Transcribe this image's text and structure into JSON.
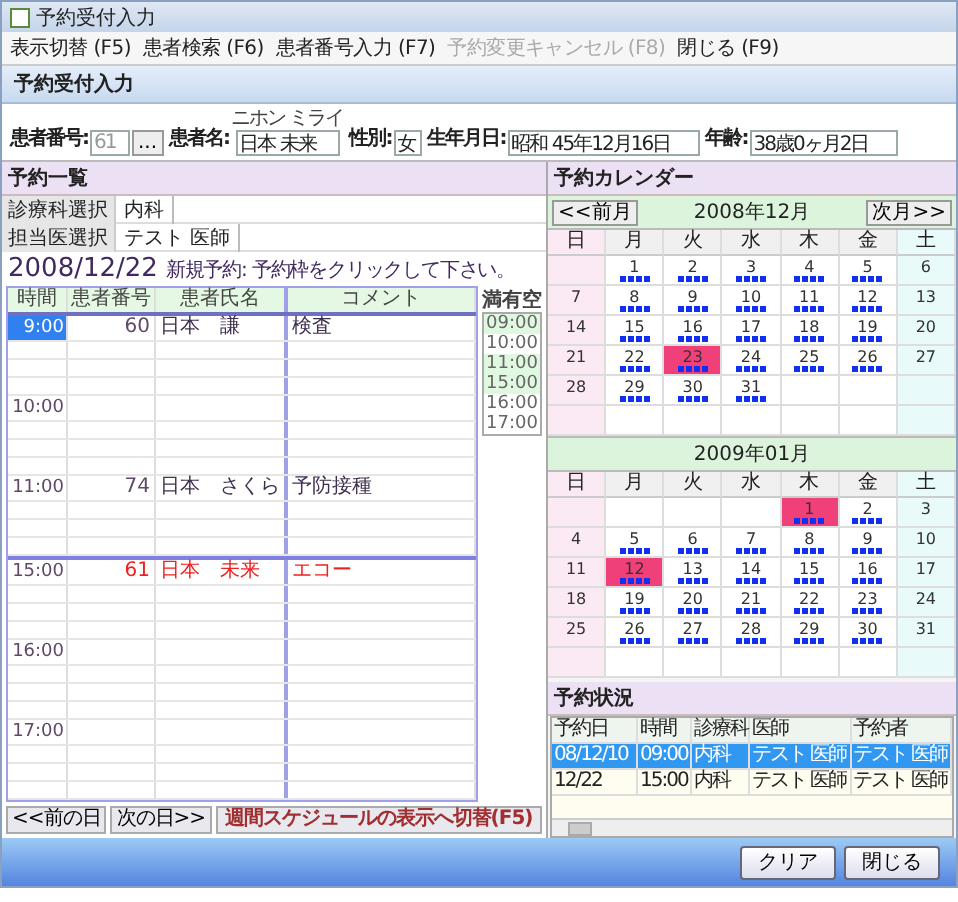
{
  "window": {
    "title": "予約受付入力"
  },
  "menu": [
    {
      "label": "表示切替",
      "key": "(F5)",
      "disabled": false
    },
    {
      "label": "患者検索",
      "key": "(F6)",
      "disabled": false
    },
    {
      "label": "患者番号入力",
      "key": "(F7)",
      "disabled": false
    },
    {
      "label": "予約変更キャンセル",
      "key": "(F8)",
      "disabled": true
    },
    {
      "label": "閉じる",
      "key": "(F9)",
      "disabled": false
    }
  ],
  "heading": "予約受付入力",
  "patient": {
    "number_label": "患者番号:",
    "number": "61",
    "browse": "...",
    "name_label": "患者名:",
    "name_reading": "ニホン ミライ",
    "name": "日本 未来",
    "sex_label": "性別:",
    "sex": "女",
    "birth_label": "生年月日:",
    "birth": "昭和 45年12月16日",
    "age_label": "年齢:",
    "age": "38歳0ヶ月2日"
  },
  "list": {
    "title": "予約一覧",
    "department_label": "診療科選択",
    "department": "内科",
    "doctor_label": "担当医選択",
    "doctor": "テスト 医師",
    "date": "2008/12/22",
    "hint": "新規予約: 予約枠をクリックして下さい。",
    "columns": [
      "時間",
      "患者番号",
      "患者氏名",
      "コメント"
    ],
    "hours": [
      {
        "time": "9:00",
        "selected": true,
        "break_before": false,
        "booking": {
          "number": "60",
          "name": "日本　謙",
          "comment": "検査",
          "current": false
        }
      },
      {
        "time": "10:00",
        "selected": false,
        "break_before": false
      },
      {
        "time": "11:00",
        "selected": false,
        "break_before": false,
        "booking": {
          "number": "74",
          "name": "日本　さくら",
          "comment": "予防接種",
          "current": false
        }
      },
      {
        "time": "15:00",
        "selected": false,
        "break_before": true,
        "booking": {
          "number": "61",
          "name": "日本　未来",
          "comment": "エコー",
          "current": true
        }
      },
      {
        "time": "16:00",
        "selected": false,
        "break_before": false
      },
      {
        "time": "17:00",
        "selected": false,
        "break_before": false
      }
    ],
    "availability": {
      "columns": [
        "満",
        "有",
        "空"
      ],
      "times": [
        {
          "time": "09:00",
          "booked": true
        },
        {
          "time": "10:00",
          "booked": false
        },
        {
          "time": "11:00",
          "booked": true
        },
        {
          "time": "15:00",
          "booked": true
        },
        {
          "time": "16:00",
          "booked": false
        },
        {
          "time": "17:00",
          "booked": false
        }
      ]
    },
    "prev_day": "<<前の日",
    "next_day": "次の日>>",
    "week_toggle": "週間スケジュールの表示へ切替(F5)"
  },
  "calendar": {
    "title": "予約カレンダー",
    "prev": "<<前月",
    "next": "次月>>",
    "months": [
      {
        "title": "2008年12月",
        "weekdays": [
          "日",
          "月",
          "火",
          "水",
          "木",
          "金",
          "土"
        ],
        "weeks": [
          [
            {
              "label": "1",
              "available": true,
              "holiday": false
            },
            {
              "label": "2",
              "available": true,
              "holiday": false
            },
            {
              "label": "3",
              "available": true,
              "holiday": false
            },
            {
              "label": "4",
              "available": true,
              "holiday": false
            },
            {
              "label": "5",
              "available": true,
              "holiday": false
            },
            {
              "label": "6",
              "available": false,
              "holiday": false
            }
          ],
          [
            {
              "label": "7",
              "available": false,
              "holiday": false
            },
            {
              "label": "8",
              "available": true,
              "holiday": false
            },
            {
              "label": "9",
              "available": true,
              "holiday": false
            },
            {
              "label": "10",
              "available": true,
              "holiday": false
            },
            {
              "label": "11",
              "available": true,
              "holiday": false
            },
            {
              "label": "12",
              "available": true,
              "holiday": false
            },
            {
              "label": "13",
              "available": false,
              "holiday": false
            }
          ],
          [
            {
              "label": "14",
              "available": false,
              "holiday": false
            },
            {
              "label": "15",
              "available": true,
              "holiday": false
            },
            {
              "label": "16",
              "available": true,
              "holiday": false
            },
            {
              "label": "17",
              "available": true,
              "holiday": false
            },
            {
              "label": "18",
              "available": true,
              "holiday": false
            },
            {
              "label": "19",
              "available": true,
              "holiday": false
            },
            {
              "label": "20",
              "available": false,
              "holiday": false
            }
          ],
          [
            {
              "label": "21",
              "available": false,
              "holiday": false
            },
            {
              "label": "22",
              "available": true,
              "holiday": false
            },
            {
              "label": "23",
              "available": true,
              "holiday": true
            },
            {
              "label": "24",
              "available": true,
              "holiday": false
            },
            {
              "label": "25",
              "available": true,
              "holiday": false
            },
            {
              "label": "26",
              "available": true,
              "holiday": false
            },
            {
              "label": "27",
              "available": false,
              "holiday": false
            }
          ],
          [
            {
              "label": "28",
              "available": false,
              "holiday": false
            },
            {
              "label": "29",
              "available": true,
              "holiday": false
            },
            {
              "label": "30",
              "available": true,
              "holiday": false
            },
            {
              "label": "31",
              "available": true,
              "holiday": false
            }
          ]
        ]
      },
      {
        "title": "2009年01月",
        "weekdays": [
          "日",
          "月",
          "火",
          "水",
          "木",
          "金",
          "土"
        ],
        "weeks": [
          [
            {
              "label": "1",
              "available": true,
              "holiday": true
            },
            {
              "label": "2",
              "available": true,
              "holiday": false
            },
            {
              "label": "3",
              "available": false,
              "holiday": false
            }
          ],
          [
            {
              "label": "4",
              "available": false,
              "holiday": false
            },
            {
              "label": "5",
              "available": true,
              "holiday": false
            },
            {
              "label": "6",
              "available": true,
              "holiday": false
            },
            {
              "label": "7",
              "available": true,
              "holiday": false
            },
            {
              "label": "8",
              "available": true,
              "holiday": false
            },
            {
              "label": "9",
              "available": true,
              "holiday": false
            },
            {
              "label": "10",
              "available": false,
              "holiday": false
            }
          ],
          [
            {
              "label": "11",
              "available": false,
              "holiday": false
            },
            {
              "label": "12",
              "available": true,
              "holiday": true
            },
            {
              "label": "13",
              "available": true,
              "holiday": false
            },
            {
              "label": "14",
              "available": true,
              "holiday": false
            },
            {
              "label": "15",
              "available": true,
              "holiday": false
            },
            {
              "label": "16",
              "available": true,
              "holiday": false
            },
            {
              "label": "17",
              "available": false,
              "holiday": false
            }
          ],
          [
            {
              "label": "18",
              "available": false,
              "holiday": false
            },
            {
              "label": "19",
              "available": true,
              "holiday": false
            },
            {
              "label": "20",
              "available": true,
              "holiday": false
            },
            {
              "label": "21",
              "available": true,
              "holiday": false
            },
            {
              "label": "22",
              "available": true,
              "holiday": false
            },
            {
              "label": "23",
              "available": true,
              "holiday": false
            },
            {
              "label": "24",
              "available": false,
              "holiday": false
            }
          ],
          [
            {
              "label": "25",
              "available": false,
              "holiday": false
            },
            {
              "label": "26",
              "available": true,
              "holiday": false
            },
            {
              "label": "27",
              "available": true,
              "holiday": false
            },
            {
              "label": "28",
              "available": true,
              "holiday": false
            },
            {
              "label": "29",
              "available": true,
              "holiday": false
            },
            {
              "label": "30",
              "available": true,
              "holiday": false
            },
            {
              "label": "31",
              "available": false,
              "holiday": false
            }
          ]
        ]
      }
    ]
  },
  "status": {
    "title": "予約状況",
    "columns": [
      "予約日",
      "時間",
      "診療科",
      "医師",
      "予約者"
    ],
    "rows": [
      {
        "cells": [
          "08/12/10",
          "09:00",
          "内科",
          "テスト 医師",
          "テスト 医師"
        ],
        "selected": true
      },
      {
        "cells": [
          "12/22",
          "15:00",
          "内科",
          "テスト 医師",
          "テスト 医師"
        ],
        "selected": false
      }
    ]
  },
  "buttons": [
    "クリア",
    "閉じる"
  ]
}
